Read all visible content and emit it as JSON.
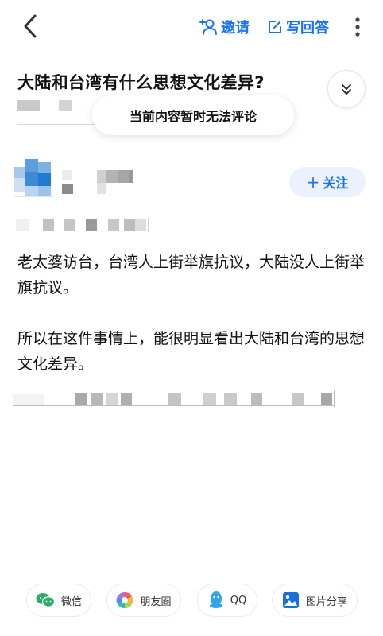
{
  "header": {
    "invite_label": "邀请",
    "answer_label": "写回答"
  },
  "question": {
    "title": "大陆和台湾有什么思想文化差异?"
  },
  "toast": {
    "message": "当前内容暂时无法评论"
  },
  "author": {
    "follow_label": "关注"
  },
  "answer": {
    "paragraphs": [
      "老太婆访台，台湾人上街举旗抗议，大陆没人上街举旗抗议。",
      "所以在这件事情上，能很明显看出大陆和台湾的思想文化差异。"
    ]
  },
  "share_bar": {
    "items": [
      {
        "label": "微信",
        "icon": "wechat-icon"
      },
      {
        "label": "朋友圈",
        "icon": "moments-icon"
      },
      {
        "label": "QQ",
        "icon": "qq-icon"
      },
      {
        "label": "图片分享",
        "icon": "image-share-icon"
      }
    ]
  },
  "colors": {
    "accent": "#1772f6",
    "follow_bg": "#ebf2fd",
    "text": "#121212"
  }
}
